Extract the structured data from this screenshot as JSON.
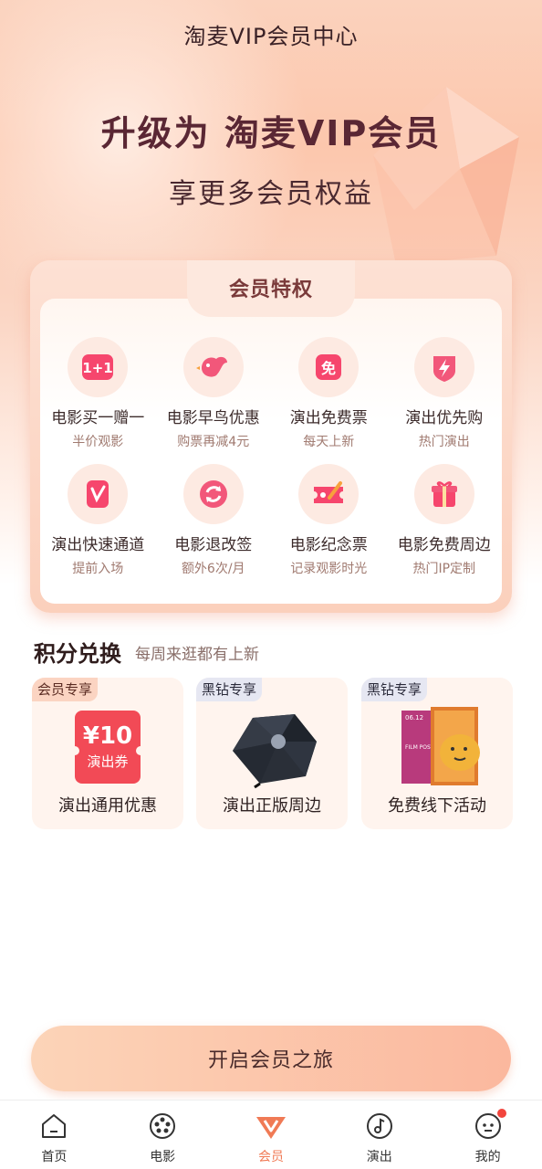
{
  "header": {
    "title": "淘麦VIP会员中心",
    "hero_title": "升级为 淘麦VIP会员",
    "hero_subtitle": "享更多会员权益"
  },
  "privileges": {
    "section_title": "会员特权",
    "items": [
      {
        "name": "电影买一赠一",
        "desc": "半价观影",
        "icon": "one-plus-one-icon"
      },
      {
        "name": "电影早鸟优惠",
        "desc": "购票再减4元",
        "icon": "early-bird-icon"
      },
      {
        "name": "演出免费票",
        "desc": "每天上新",
        "icon": "free-ticket-icon"
      },
      {
        "name": "演出优先购",
        "desc": "热门演出",
        "icon": "priority-lightning-icon"
      },
      {
        "name": "演出快速通道",
        "desc": "提前入场",
        "icon": "fast-lane-icon"
      },
      {
        "name": "电影退改签",
        "desc": "额外6次/月",
        "icon": "refund-change-icon"
      },
      {
        "name": "电影纪念票",
        "desc": "记录观影时光",
        "icon": "souvenir-ticket-icon"
      },
      {
        "name": "电影免费周边",
        "desc": "热门IP定制",
        "icon": "gift-box-icon"
      }
    ]
  },
  "points": {
    "title": "积分兑换",
    "subtitle": "每周来逛都有上新",
    "cards": [
      {
        "tag": "会员专享",
        "label": "演出通用优惠",
        "coupon_amount": "¥10",
        "coupon_text": "演出券"
      },
      {
        "tag": "黑钻专享",
        "label": "演出正版周边"
      },
      {
        "tag": "黑钻专享",
        "label": "免费线下活动",
        "poster_date": "06.12",
        "poster_text": "FILM POSTER ART"
      }
    ]
  },
  "cta": {
    "label": "开启会员之旅"
  },
  "tabbar": {
    "items": [
      {
        "label": "首页",
        "icon": "home-icon"
      },
      {
        "label": "电影",
        "icon": "film-reel-icon"
      },
      {
        "label": "会员",
        "icon": "vip-v-icon"
      },
      {
        "label": "演出",
        "icon": "music-note-icon"
      },
      {
        "label": "我的",
        "icon": "profile-face-icon"
      }
    ],
    "active_index": 2
  },
  "colors": {
    "accent": "#f07a55",
    "hero_title": "#5a2734",
    "cta_start": "#fcd4b8",
    "cta_end": "#fbb89e",
    "badge_dot": "#f2453d"
  }
}
